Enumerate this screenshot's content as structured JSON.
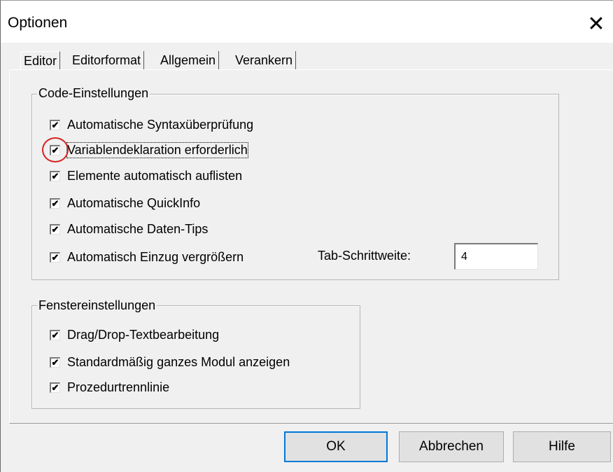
{
  "window": {
    "title": "Optionen",
    "close_glyph": "✕"
  },
  "tabs": [
    {
      "label": "Editor",
      "active": true
    },
    {
      "label": "Editorformat"
    },
    {
      "label": "Allgemein"
    },
    {
      "label": "Verankern"
    }
  ],
  "code_settings": {
    "legend": "Code-Einstellungen",
    "items": [
      {
        "label": "Automatische Syntaxüberprüfung",
        "checked": true
      },
      {
        "label": "Variablendeklaration erforderlich",
        "checked": true
      },
      {
        "label": "Elemente automatisch auflisten",
        "checked": true
      },
      {
        "label": "Automatische QuickInfo",
        "checked": true
      },
      {
        "label": "Automatische Daten-Tips",
        "checked": true
      },
      {
        "label": "Automatisch Einzug vergrößern",
        "checked": true
      }
    ],
    "tab_width_label": "Tab-Schrittweite:",
    "tab_width_value": "4"
  },
  "window_settings": {
    "legend": "Fenstereinstellungen",
    "items": [
      {
        "label": "Drag/Drop-Textbearbeitung",
        "checked": true
      },
      {
        "label": "Standardmäßig ganzes Modul anzeigen",
        "checked": true
      },
      {
        "label": "Prozedurtrennlinie",
        "checked": true
      }
    ]
  },
  "buttons": {
    "ok": "OK",
    "cancel": "Abbrechen",
    "help": "Hilfe"
  },
  "check_glyph": "✔",
  "colors": {
    "highlight_circle": "#d62020",
    "default_button_border": "#0078d7"
  }
}
